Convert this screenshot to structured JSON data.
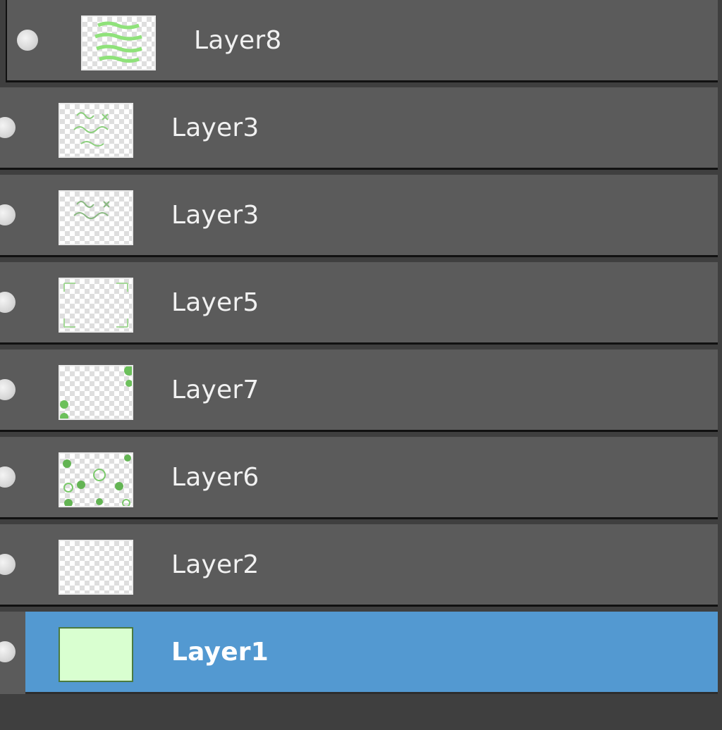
{
  "layers_panel": {
    "accent_color": "#5399d1",
    "row_color": "#5b5b5b",
    "layers": [
      {
        "name": "Layer8",
        "icon": "eye-visibility-icon",
        "thumbnail_fill": ""
      },
      {
        "name": "Layer3",
        "icon": "eye-visibility-icon",
        "thumbnail_fill": ""
      },
      {
        "name": "Layer3",
        "icon": "eye-visibility-icon",
        "thumbnail_fill": ""
      },
      {
        "name": "Layer5",
        "icon": "eye-visibility-icon",
        "thumbnail_fill": ""
      },
      {
        "name": "Layer7",
        "icon": "eye-visibility-icon",
        "thumbnail_fill": ""
      },
      {
        "name": "Layer6",
        "icon": "eye-visibility-icon",
        "thumbnail_fill": ""
      },
      {
        "name": "Layer2",
        "icon": "eye-visibility-icon",
        "thumbnail_fill": ""
      },
      {
        "name": "Layer1",
        "icon": "eye-visibility-icon",
        "thumbnail_fill": "#d9ffd0",
        "selected": true
      }
    ]
  }
}
